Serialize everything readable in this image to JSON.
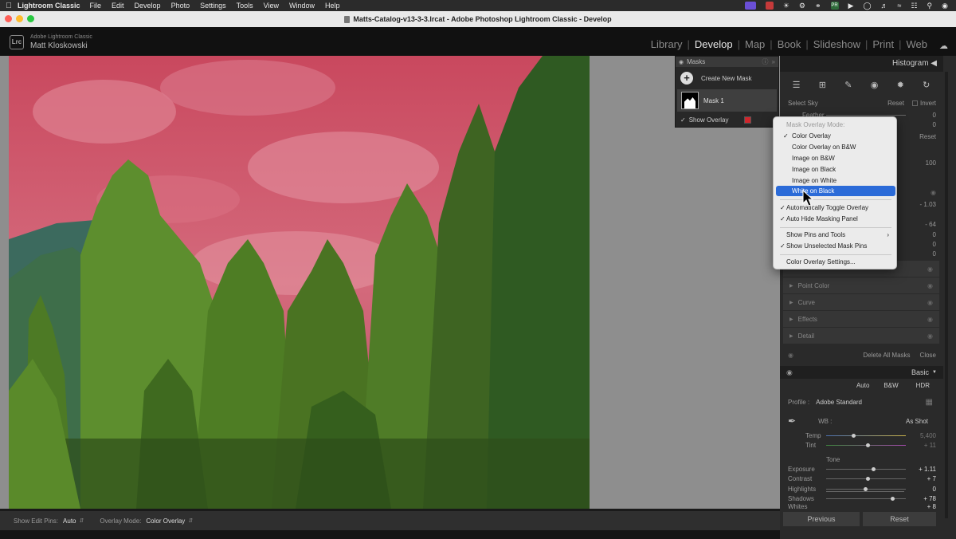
{
  "menubar": {
    "app": "Lightroom Classic",
    "items": [
      "File",
      "Edit",
      "Develop",
      "Photo",
      "Settings",
      "Tools",
      "View",
      "Window",
      "Help"
    ]
  },
  "window": {
    "title": "Matts-Catalog-v13-3-3.lrcat - Adobe Photoshop Lightroom Classic - Develop"
  },
  "identity": {
    "product": "Adobe Lightroom Classic",
    "user": "Matt Kloskowski",
    "logo": "Lrc"
  },
  "modules": [
    {
      "label": "Library",
      "active": false
    },
    {
      "label": "Develop",
      "active": true
    },
    {
      "label": "Map",
      "active": false
    },
    {
      "label": "Book",
      "active": false
    },
    {
      "label": "Slideshow",
      "active": false
    },
    {
      "label": "Print",
      "active": false
    },
    {
      "label": "Web",
      "active": false
    }
  ],
  "masks_panel": {
    "title": "Masks",
    "create_label": "Create New Mask",
    "mask_name": "Mask 1",
    "show_overlay_label": "Show Overlay",
    "overlay_color": "#d0262c"
  },
  "overlay_menu": {
    "header": "Mask Overlay Mode:",
    "modes": [
      {
        "label": "Color Overlay",
        "checked": true
      },
      {
        "label": "Color Overlay on B&W",
        "checked": false
      },
      {
        "label": "Image on B&W",
        "checked": false
      },
      {
        "label": "Image on Black",
        "checked": false
      },
      {
        "label": "Image on White",
        "checked": false
      },
      {
        "label": "White on Black",
        "checked": false,
        "highlighted": true
      }
    ],
    "toggle_auto": "Automatically Toggle Overlay",
    "auto_hide": "Auto Hide Masking Panel",
    "show_pins": "Show Pins and Tools",
    "show_unselected": "Show Unselected Mask Pins",
    "settings": "Color Overlay Settings..."
  },
  "right_panel": {
    "histogram": "Histogram",
    "select_sky": "Select Sky",
    "reset": "Reset",
    "invert": "Invert",
    "feather": "Feather",
    "feather_value": "0",
    "amount_value": "0",
    "reset2": "Reset",
    "value_100": "100",
    "value_neg103": "- 1.03",
    "value_neg64": "- 64",
    "zeros": [
      "0",
      "0",
      "0",
      "0",
      "0"
    ],
    "sections": [
      "Point Color",
      "Curve",
      "Effects",
      "Detail"
    ],
    "delete_all": "Delete All Masks",
    "close": "Close",
    "basic": "Basic",
    "auto": "Auto",
    "bw": "B&W",
    "hdr": "HDR",
    "profile_label": "Profile :",
    "profile_value": "Adobe Standard",
    "wb_label": "WB :",
    "wb_value": "As Shot",
    "temp_label": "Temp",
    "temp_value": "5,400",
    "tint_label": "Tint",
    "tint_value": "+ 11",
    "tone": "Tone",
    "exposure_label": "Exposure",
    "exposure_value": "+ 1.11",
    "contrast_label": "Contrast",
    "contrast_value": "+ 7",
    "highlights_label": "Highlights",
    "highlights_value": "0",
    "shadows_label": "Shadows",
    "shadows_value": "+ 78",
    "whites_label": "Whites",
    "whites_value": "+ 8",
    "previous": "Previous",
    "reset_btn": "Reset"
  },
  "toolbar": {
    "pins_label": "Show Edit Pins:",
    "pins_value": "Auto",
    "overlay_label": "Overlay Mode:",
    "overlay_value": "Color Overlay"
  },
  "colors": {
    "overlay": "#d0262c",
    "menu_highlight": "#2b6bd8"
  }
}
